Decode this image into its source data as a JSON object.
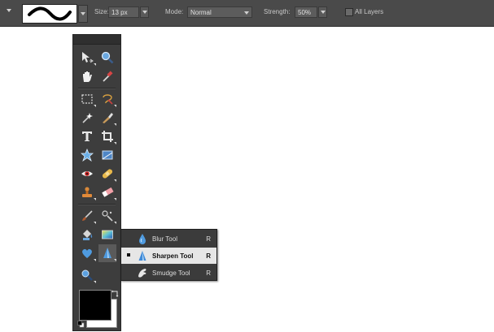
{
  "options_bar": {
    "size_label": "Size:",
    "size_value": "13 px",
    "mode_label": "Mode:",
    "mode_value": "Normal",
    "strength_label": "Strength:",
    "strength_value": "50%",
    "all_layers_label": "All Layers",
    "all_layers_checked": false
  },
  "toolbox": {
    "tools": [
      {
        "name": "move-tool-icon"
      },
      {
        "name": "zoom-tool-icon"
      },
      {
        "name": "hand-tool-icon"
      },
      {
        "name": "eyedropper-tool-icon"
      },
      {
        "name": "marquee-tool-icon"
      },
      {
        "name": "lasso-tool-icon"
      },
      {
        "name": "magic-wand-tool-icon"
      },
      {
        "name": "quick-selection-tool-icon"
      },
      {
        "name": "type-tool-icon"
      },
      {
        "name": "crop-tool-icon"
      },
      {
        "name": "cookie-cutter-tool-icon"
      },
      {
        "name": "straighten-tool-icon"
      },
      {
        "name": "red-eye-tool-icon"
      },
      {
        "name": "healing-brush-tool-icon"
      },
      {
        "name": "clone-stamp-tool-icon"
      },
      {
        "name": "eraser-tool-icon"
      },
      {
        "name": "brush-tool-icon"
      },
      {
        "name": "smart-brush-tool-icon"
      },
      {
        "name": "paint-bucket-tool-icon"
      },
      {
        "name": "gradient-tool-icon"
      },
      {
        "name": "shape-tool-icon"
      },
      {
        "name": "sharpen-tool-icon"
      },
      {
        "name": "sponge-tool-icon"
      }
    ],
    "foreground_color": "#000000",
    "background_color": "#ffffff"
  },
  "flyout": {
    "items": [
      {
        "label": "Blur Tool",
        "shortcut": "R",
        "selected": false,
        "icon": "blur-drop-icon"
      },
      {
        "label": "Sharpen Tool",
        "shortcut": "R",
        "selected": true,
        "icon": "sharpen-cone-icon"
      },
      {
        "label": "Smudge Tool",
        "shortcut": "R",
        "selected": false,
        "icon": "smudge-finger-icon"
      }
    ]
  }
}
